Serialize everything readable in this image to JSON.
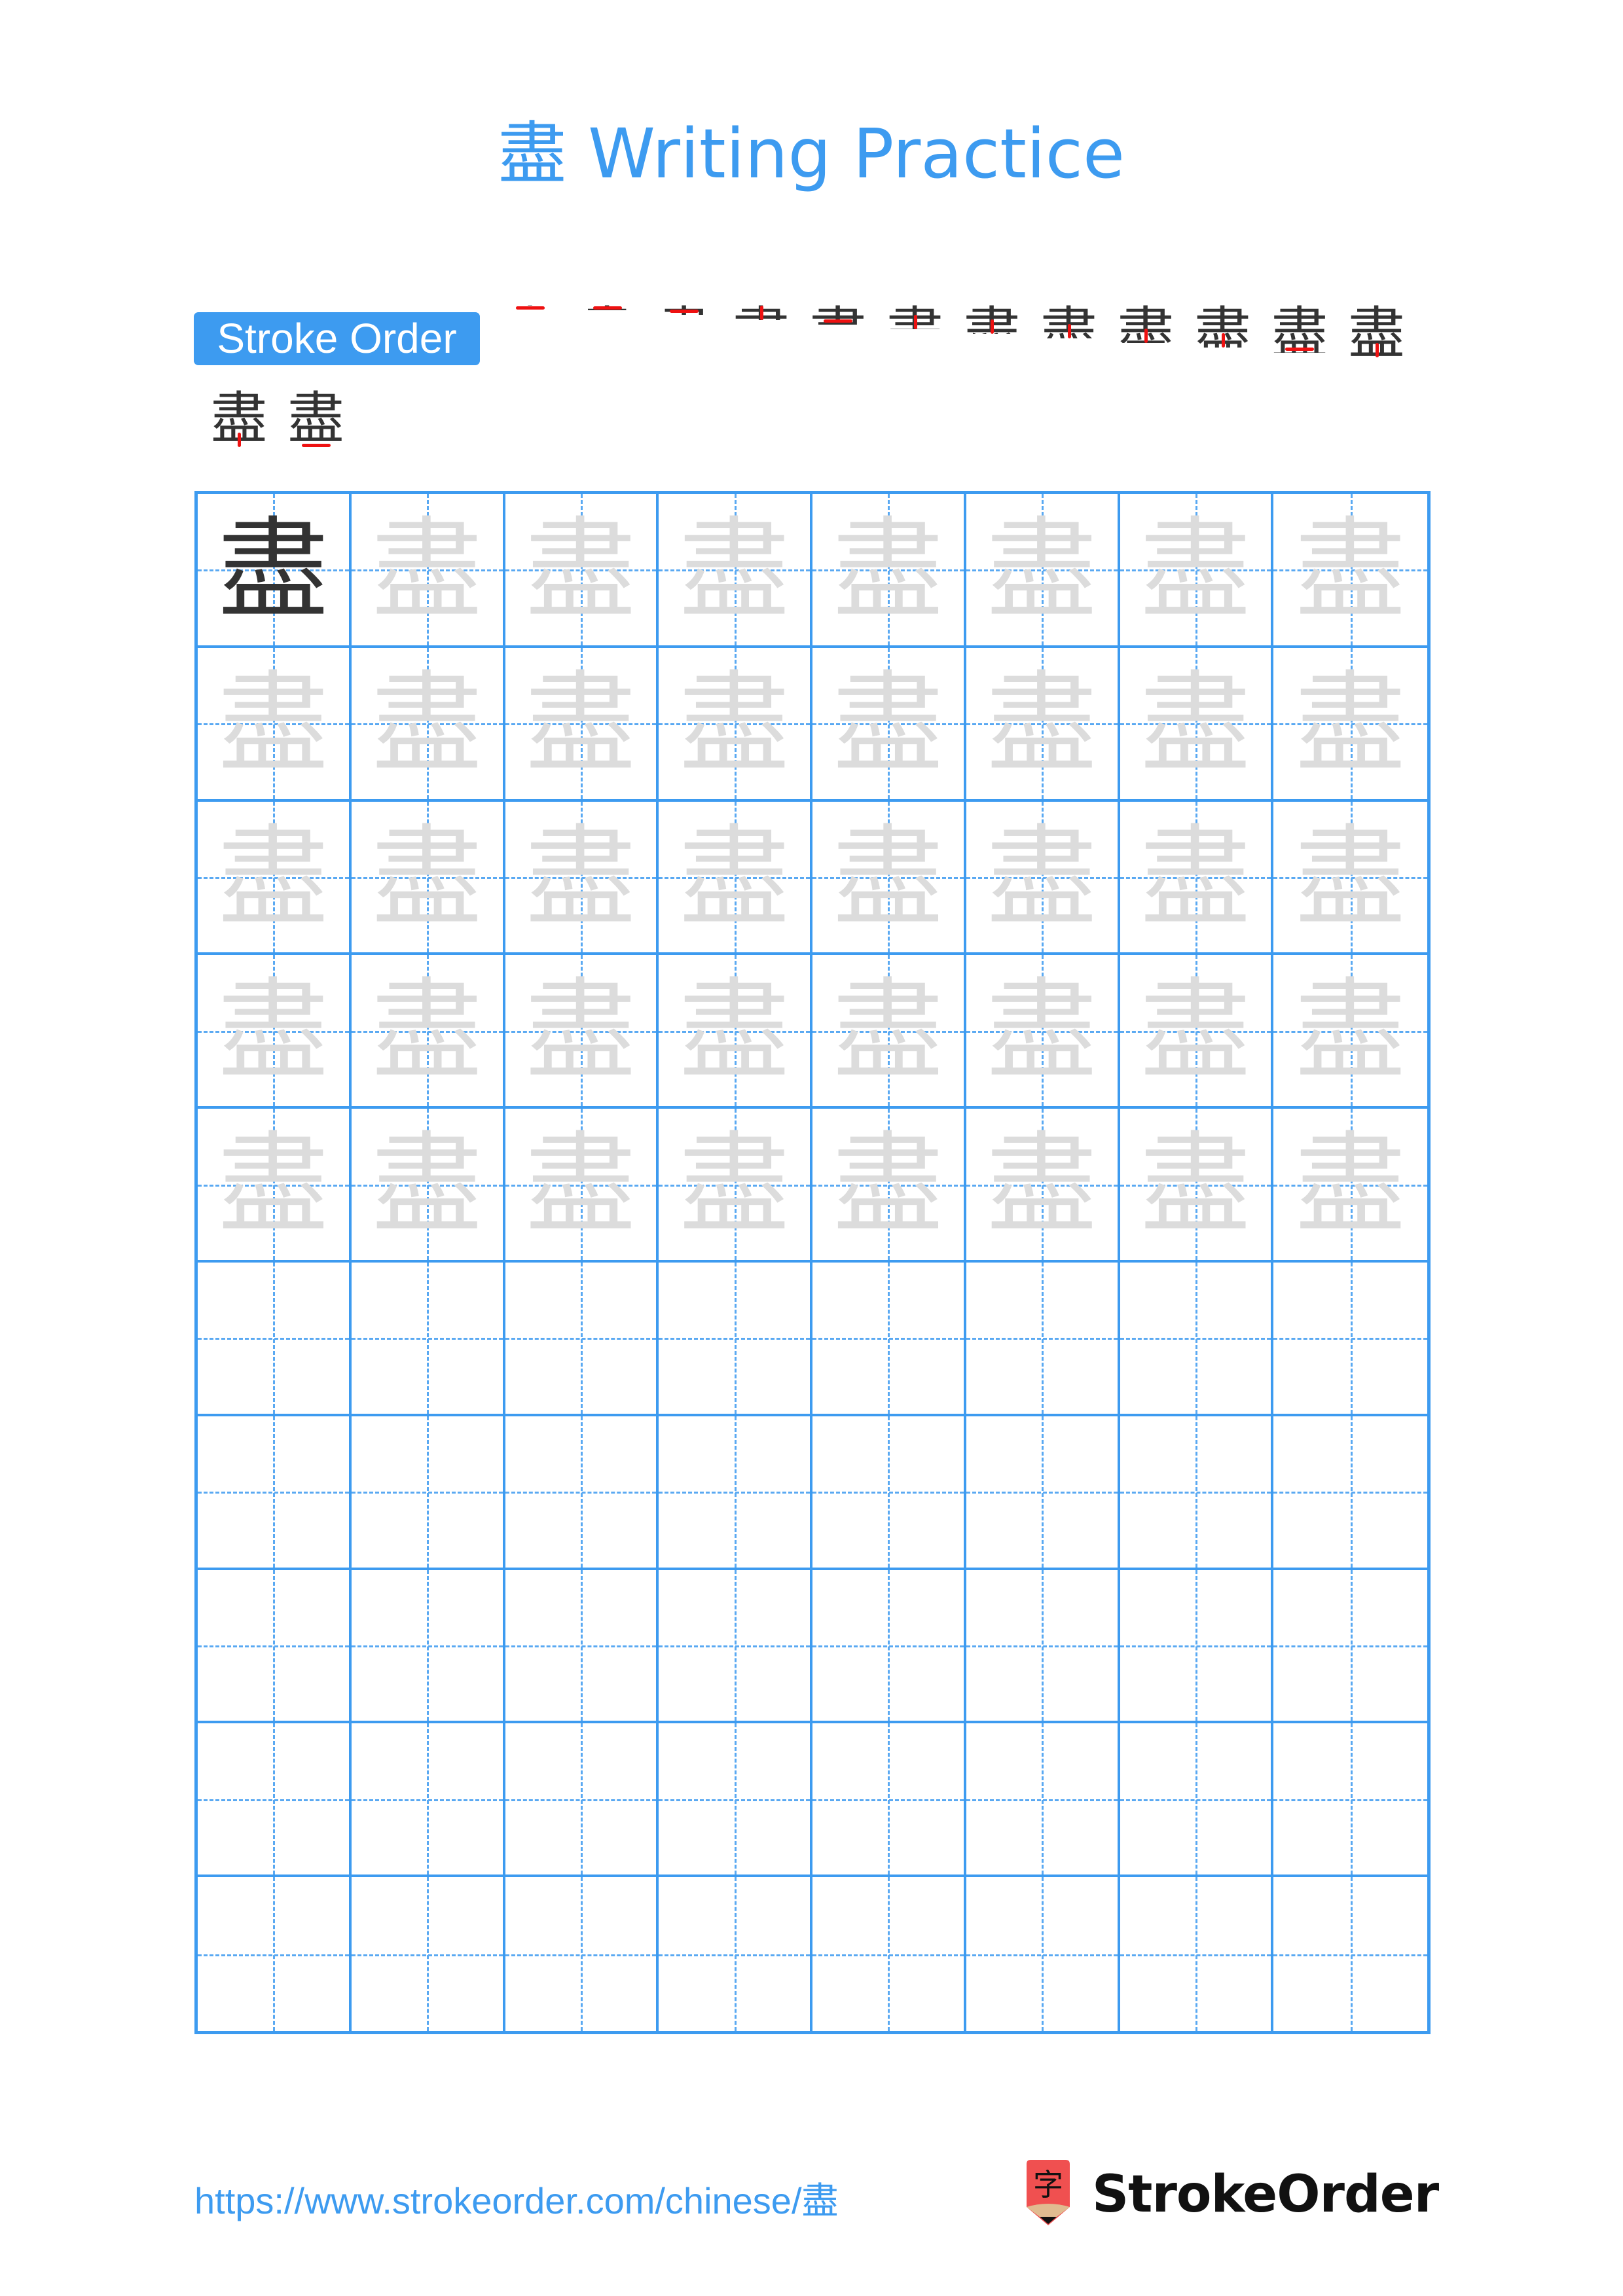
{
  "page": {
    "title": "盡 Writing Practice",
    "character": "盡"
  },
  "stroke_order": {
    "label": "Stroke Order",
    "total_strokes": 14,
    "steps": [
      {
        "step": 1,
        "stroke": "horizontal-turn (横折)"
      },
      {
        "step": 2,
        "stroke": "horizontal (横)"
      },
      {
        "step": 3,
        "stroke": "horizontal (横)"
      },
      {
        "step": 4,
        "stroke": "vertical (竖)"
      },
      {
        "step": 5,
        "stroke": "horizontal (横)"
      },
      {
        "step": 6,
        "stroke": "dot (点)"
      },
      {
        "step": 7,
        "stroke": "dot (点)"
      },
      {
        "step": 8,
        "stroke": "dot (点)"
      },
      {
        "step": 9,
        "stroke": "dot (点)"
      },
      {
        "step": 10,
        "stroke": "vertical (竖)"
      },
      {
        "step": 11,
        "stroke": "horizontal-turn (横折)"
      },
      {
        "step": 12,
        "stroke": "vertical (竖)"
      },
      {
        "step": 13,
        "stroke": "vertical (竖)"
      },
      {
        "step": 14,
        "stroke": "horizontal (横)"
      }
    ]
  },
  "practice_grid": {
    "columns": 8,
    "rows": 10,
    "model_cells": 1,
    "trace_rows": 5,
    "empty_rows": 5,
    "colors": {
      "grid_line": "#3d9bf0",
      "model_char": "#333333",
      "trace_char": "#dcdcdc",
      "highlight_stroke": "#ee1111"
    }
  },
  "footer": {
    "url": "https://www.strokeorder.com/chinese/盡",
    "brand": "StrokeOrder",
    "logo_glyph": "字"
  },
  "colors": {
    "accent": "#3d9bf0",
    "logo_red": "#f05050",
    "logo_tan": "#e0bb90"
  }
}
